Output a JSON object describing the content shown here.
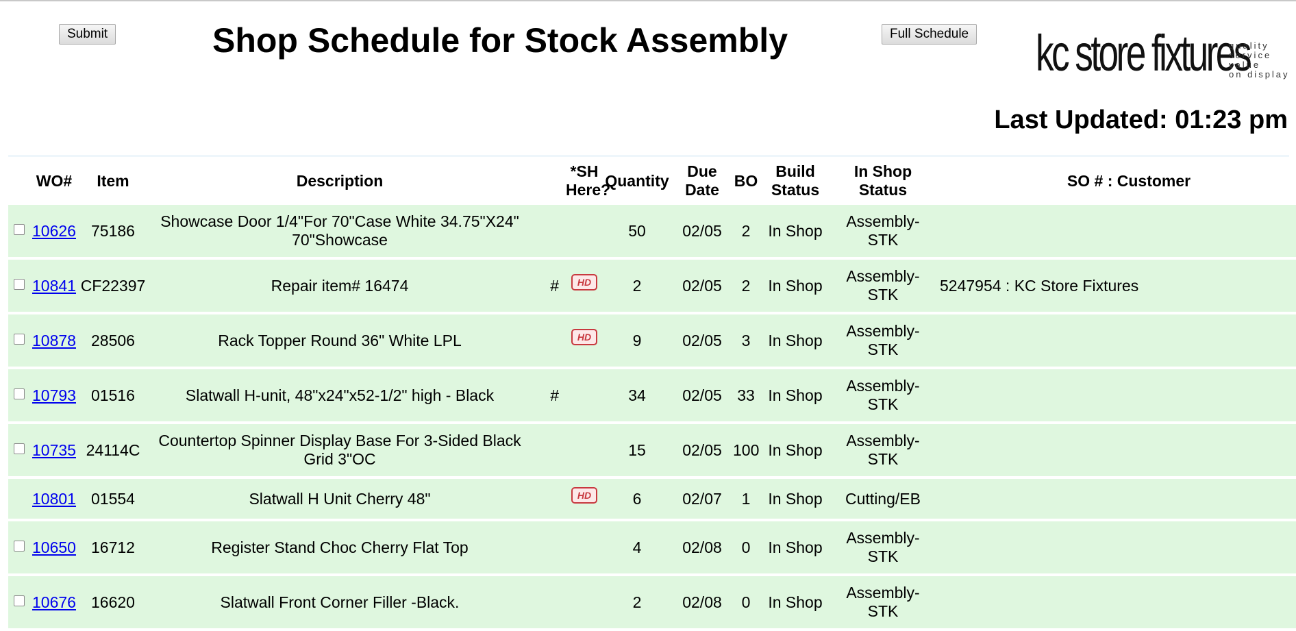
{
  "header": {
    "submit_label": "Submit",
    "title": "Shop Schedule for Stock Assembly",
    "full_schedule_label": "Full Schedule",
    "logo_text": "kc store fixtures",
    "logo_tagline": [
      "quality",
      "service",
      "value",
      "on display"
    ],
    "last_updated": "Last Updated: 01:23 pm"
  },
  "columns": {
    "wo": "WO#",
    "item": "Item",
    "description": "Description",
    "sh": [
      "*SH",
      "Here?"
    ],
    "quantity": "Quantity",
    "due_date": [
      "Due",
      "Date"
    ],
    "bo": "BO",
    "build_status": [
      "Build",
      "Status"
    ],
    "in_shop_status": [
      "In Shop",
      "Status"
    ],
    "customer": "SO # : Customer"
  },
  "rows": [
    {
      "checkbox": true,
      "wo": "10626",
      "item": "75186",
      "description": [
        "Showcase Door 1/4\"For 70\"Case White 34.75\"X24\"",
        "70\"Showcase"
      ],
      "hash": "",
      "hd": false,
      "quantity": "50",
      "due": "02/05",
      "bo": "2",
      "build": "In Shop",
      "in_shop": [
        "Assembly-",
        "STK"
      ],
      "customer": ""
    },
    {
      "checkbox": true,
      "wo": "10841",
      "item": "CF22397",
      "description": [
        "Repair item# 16474"
      ],
      "hash": "#",
      "hd": true,
      "quantity": "2",
      "due": "02/05",
      "bo": "2",
      "build": "In Shop",
      "in_shop": [
        "Assembly-",
        "STK"
      ],
      "customer": "5247954 : KC Store Fixtures"
    },
    {
      "checkbox": true,
      "wo": "10878",
      "item": "28506",
      "description": [
        "Rack Topper Round 36\" White LPL"
      ],
      "hash": "",
      "hd": true,
      "quantity": "9",
      "due": "02/05",
      "bo": "3",
      "build": "In Shop",
      "in_shop": [
        "Assembly-",
        "STK"
      ],
      "customer": ""
    },
    {
      "checkbox": true,
      "wo": "10793",
      "item": "01516",
      "description": [
        "Slatwall H-unit, 48\"x24\"x52-1/2\" high - Black"
      ],
      "hash": "#",
      "hd": false,
      "quantity": "34",
      "due": "02/05",
      "bo": "33",
      "build": "In Shop",
      "in_shop": [
        "Assembly-",
        "STK"
      ],
      "customer": ""
    },
    {
      "checkbox": true,
      "wo": "10735",
      "item": "24114C",
      "description": [
        "Countertop Spinner Display Base For 3-Sided Black",
        "Grid 3\"OC"
      ],
      "hash": "",
      "hd": false,
      "quantity": "15",
      "due": "02/05",
      "bo": "100",
      "build": "In Shop",
      "in_shop": [
        "Assembly-",
        "STK"
      ],
      "customer": ""
    },
    {
      "checkbox": false,
      "wo": "10801",
      "item": "01554",
      "description": [
        "Slatwall H Unit Cherry 48\""
      ],
      "hash": "",
      "hd": true,
      "quantity": "6",
      "due": "02/07",
      "bo": "1",
      "build": "In Shop",
      "in_shop": [
        "Cutting/EB"
      ],
      "customer": ""
    },
    {
      "checkbox": true,
      "wo": "10650",
      "item": "16712",
      "description": [
        "Register Stand Choc Cherry Flat Top"
      ],
      "hash": "",
      "hd": false,
      "quantity": "4",
      "due": "02/08",
      "bo": "0",
      "build": "In Shop",
      "in_shop": [
        "Assembly-",
        "STK"
      ],
      "customer": ""
    },
    {
      "checkbox": true,
      "wo": "10676",
      "item": "16620",
      "description": [
        "Slatwall Front Corner Filler -Black."
      ],
      "hash": "",
      "hd": false,
      "quantity": "2",
      "due": "02/08",
      "bo": "0",
      "build": "In Shop",
      "in_shop": [
        "Assembly-",
        "STK"
      ],
      "customer": ""
    }
  ],
  "badge_label": "HD",
  "colors": {
    "row_bg": "#dff7df",
    "link": "#0000ee",
    "badge": "#c8393f"
  }
}
